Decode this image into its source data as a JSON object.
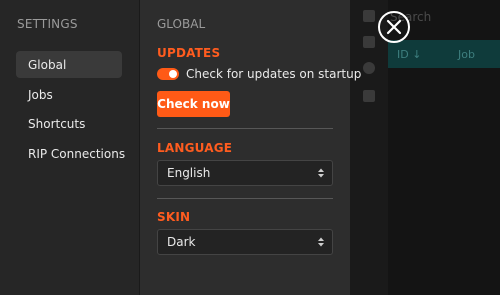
{
  "nav": {
    "title": "SETTINGS",
    "items": [
      {
        "label": "Global",
        "active": true
      },
      {
        "label": "Jobs"
      },
      {
        "label": "Shortcuts"
      },
      {
        "label": "RIP Connections"
      }
    ]
  },
  "panel": {
    "title": "GLOBAL",
    "updates": {
      "title": "UPDATES",
      "toggle_label": "Check for updates on startup",
      "toggle_on": true,
      "check_button": "Check now"
    },
    "language": {
      "title": "LANGUAGE",
      "value": "English"
    },
    "skin": {
      "title": "SKIN",
      "value": "Dark"
    }
  },
  "background": {
    "search_placeholder": "Search",
    "columns": [
      "ID ↓",
      "Job"
    ]
  },
  "colors": {
    "accent": "#ff5a16",
    "panel": "#2d2d2d",
    "nav": "#262626"
  },
  "icons": [
    "close-icon",
    "chevron-updown-icon"
  ]
}
